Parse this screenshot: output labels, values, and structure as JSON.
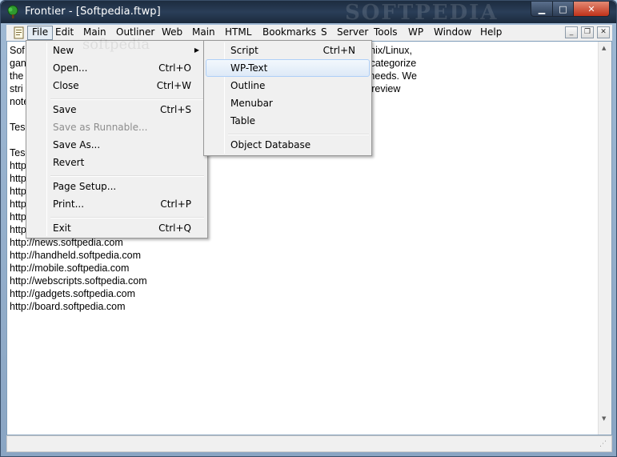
{
  "window": {
    "title": "Frontier - [Softpedia.ftwp]",
    "watermark": "SOFTPEDIA"
  },
  "menubar": {
    "items": [
      "File",
      "Edit",
      "Main",
      "Outliner",
      "Web",
      "Main",
      "HTML",
      "Bookmarks",
      "S",
      "Server",
      "Tools",
      "WP",
      "Window",
      "Help"
    ]
  },
  "document": {
    "lines": [
      "Sof                                                                                                   Windows and Unix/Linux,",
      "gan                                                                                                   We review and categorize",
      "the                                                                                                   nd their system needs. We",
      "stri                                                                                                  e evaluation and review",
      "note",
      "",
      "Tes",
      "",
      "Tes",
      "http",
      "http",
      "http",
      "http",
      "http",
      "http",
      "http://news.softpedia.com",
      "http://handheld.softpedia.com",
      "http://mobile.softpedia.com",
      "http://webscripts.softpedia.com",
      "http://gadgets.softpedia.com",
      "http://board.softpedia.com"
    ]
  },
  "file_menu": {
    "watermark": "softpedia",
    "items": [
      {
        "label": "New",
        "accel": "",
        "submenu": true
      },
      {
        "label": "Open...",
        "accel": "Ctrl+O"
      },
      {
        "label": "Close",
        "accel": "Ctrl+W"
      },
      {
        "label": "Save",
        "accel": "Ctrl+S"
      },
      {
        "label": "Save as Runnable...",
        "accel": "",
        "disabled": true
      },
      {
        "label": "Save As...",
        "accel": ""
      },
      {
        "label": "Revert",
        "accel": ""
      },
      {
        "label": "Page Setup...",
        "accel": ""
      },
      {
        "label": "Print...",
        "accel": "Ctrl+P"
      },
      {
        "label": "Exit",
        "accel": "Ctrl+Q"
      }
    ]
  },
  "new_submenu": {
    "items": [
      {
        "label": "Script",
        "accel": "Ctrl+N"
      },
      {
        "label": "WP-Text",
        "accel": "",
        "highlighted": true
      },
      {
        "label": "Outline",
        "accel": ""
      },
      {
        "label": "Menubar",
        "accel": ""
      },
      {
        "label": "Table",
        "accel": ""
      },
      {
        "label": "Object Database",
        "accel": ""
      }
    ]
  },
  "colors": {
    "menu_bg": "#f0f0f0",
    "highlight_border": "#aecff7",
    "titlebar": "#1d2c3f"
  }
}
